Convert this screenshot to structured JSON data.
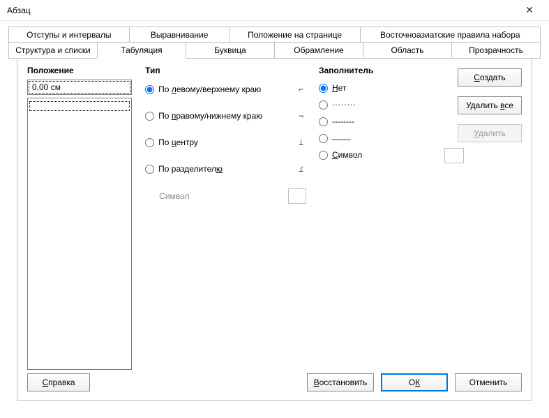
{
  "window": {
    "title": "Абзац"
  },
  "tabs_row1": [
    {
      "label": "Отступы и интервалы"
    },
    {
      "label": "Выравнивание"
    },
    {
      "label": "Положение на странице"
    },
    {
      "label": "Восточноазиатские правила набора"
    }
  ],
  "tabs_row2": [
    {
      "label": "Структура и списки"
    },
    {
      "label": "Табуляция",
      "active": true
    },
    {
      "label": "Буквица"
    },
    {
      "label": "Обрамление"
    },
    {
      "label": "Область"
    },
    {
      "label": "Прозрачность"
    }
  ],
  "sections": {
    "position_title": "Положение",
    "type_title": "Тип",
    "fill_title": "Заполнитель"
  },
  "position": {
    "value": "0,00 см"
  },
  "type": {
    "left_pre": "По ",
    "left_u": "л",
    "left_post": "евому/верхнему краю",
    "right_pre": "По ",
    "right_u": "п",
    "right_post": "равому/нижнему краю",
    "center_pre": "По ",
    "center_u": "ц",
    "center_post": "ентру",
    "decimal_pre": "По разделител",
    "decimal_u": "ю",
    "decimal_post": "",
    "symbol_label": "Символ",
    "glyph_left": "⌐",
    "glyph_right": "¬",
    "glyph_center": "⊥",
    "glyph_decimal": "⊥"
  },
  "fill": {
    "none_u": "Н",
    "none_post": "ет",
    "dots": "........",
    "dashes": "--------",
    "under": "____",
    "symbol_u": "С",
    "symbol_post": "имвол"
  },
  "side_buttons": {
    "create_u": "С",
    "create_post": "оздать",
    "delete_all_pre": "Удалить ",
    "delete_all_u": "в",
    "delete_all_post": "се",
    "delete_pre": "",
    "delete_u": "У",
    "delete_post": "далить"
  },
  "footer": {
    "help_u": "С",
    "help_post": "правка",
    "restore_u": "В",
    "restore_post": "осстановить",
    "ok_pre": "О",
    "ok_u": "К",
    "cancel_post": "Отменить"
  }
}
